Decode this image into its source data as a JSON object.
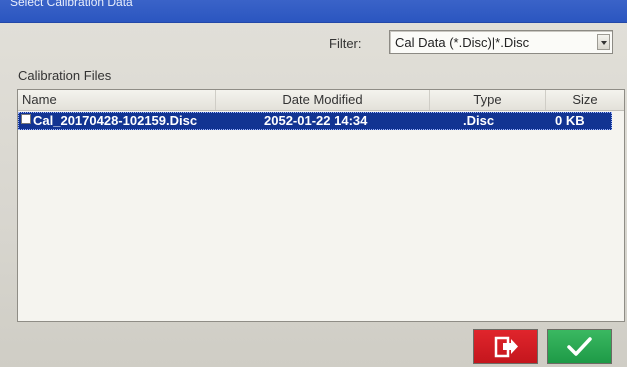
{
  "window": {
    "title": "Select Calibration Data"
  },
  "filter": {
    "label": "Filter:",
    "value": "Cal Data (*.Disc)|*.Disc"
  },
  "files_section": {
    "label": "Calibration Files"
  },
  "table": {
    "columns": [
      "Name",
      "Date Modified",
      "Type",
      "Size"
    ],
    "rows": [
      {
        "name": "Cal_20170428-102159.Disc",
        "date_modified": "2052-01-22 14:34",
        "type": ".Disc",
        "size": "0 KB",
        "selected": true
      }
    ]
  },
  "buttons": {
    "exit": {
      "icon": "exit-icon"
    },
    "ok": {
      "icon": "checkmark-icon"
    }
  },
  "colors": {
    "selection": "#123492",
    "exit_button": "#d91f26",
    "ok_button": "#27a552",
    "titlebar": "#2f5ac4"
  }
}
